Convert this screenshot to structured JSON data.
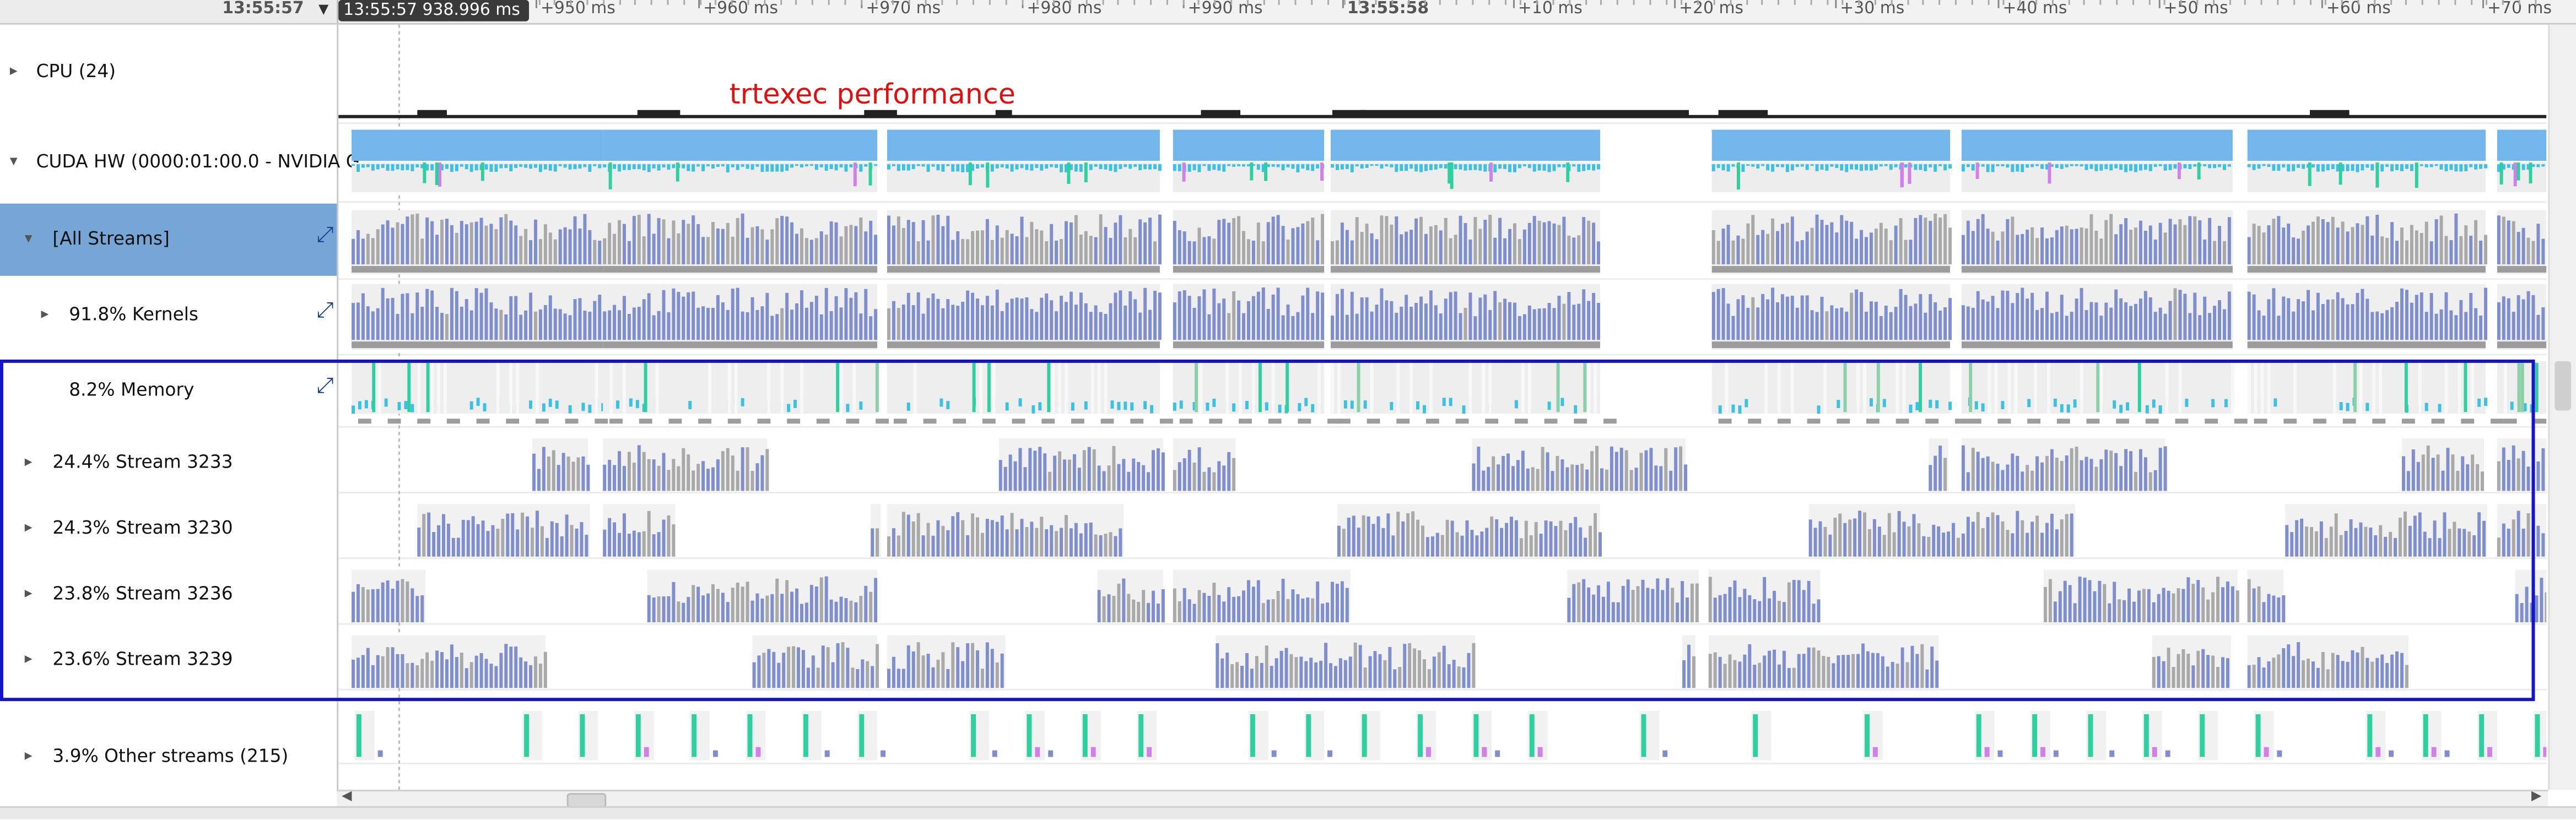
{
  "ruler": {
    "left_time": "13:55:57",
    "cursor_label": "13:55:57 938.996 ms",
    "ticks": [
      {
        "label": "+950 ms",
        "bold": false
      },
      {
        "label": "+960 ms",
        "bold": false
      },
      {
        "label": "+970 ms",
        "bold": false
      },
      {
        "label": "+980 ms",
        "bold": false
      },
      {
        "label": "+990 ms",
        "bold": false
      },
      {
        "label": "13:55:58",
        "bold": true
      },
      {
        "label": "+10 ms",
        "bold": false
      },
      {
        "label": "+20 ms",
        "bold": false
      },
      {
        "label": "+30 ms",
        "bold": false
      },
      {
        "label": "+40 ms",
        "bold": false
      },
      {
        "label": "+50 ms",
        "bold": false
      },
      {
        "label": "+60 ms",
        "bold": false
      },
      {
        "label": "+70 ms",
        "bold": false
      }
    ]
  },
  "annotation": "trtexec performance",
  "rows": [
    {
      "label": "CPU (24)",
      "arrow": "right",
      "expandable": false,
      "selected": false
    },
    {
      "label": "CUDA HW (0000:01:00.0 - NVIDIA G",
      "arrow": "down",
      "expandable": false,
      "selected": false
    },
    {
      "label": "[All Streams]",
      "arrow": "down",
      "expandable": true,
      "selected": true
    },
    {
      "label": "91.8% Kernels",
      "arrow": "right",
      "expandable": true,
      "selected": false
    },
    {
      "label": "8.2% Memory",
      "arrow": "",
      "expandable": true,
      "selected": false
    },
    {
      "label": "24.4% Stream 3233",
      "arrow": "right",
      "expandable": false,
      "selected": false
    },
    {
      "label": "24.3% Stream 3230",
      "arrow": "right",
      "expandable": false,
      "selected": false
    },
    {
      "label": "23.8% Stream 3236",
      "arrow": "right",
      "expandable": false,
      "selected": false
    },
    {
      "label": "23.6% Stream 3239",
      "arrow": "right",
      "expandable": false,
      "selected": false
    },
    {
      "label": "3.9% Other streams (215)",
      "arrow": "right",
      "expandable": false,
      "selected": false
    }
  ],
  "colors": {
    "kernel_blue": "#7f8fce",
    "kernel_gray": "#a9a9a9",
    "light_blue": "#72b6ec",
    "memcpy_cyan": "#3cc2e0",
    "memcpy_teal": "#2fd0a0",
    "memset_pink": "#d080e8",
    "bg_gray": "#e6e6e6",
    "highlight_border": "#1414c8",
    "annotation_red": "#e01010",
    "selected_row": "#76a6d6"
  }
}
